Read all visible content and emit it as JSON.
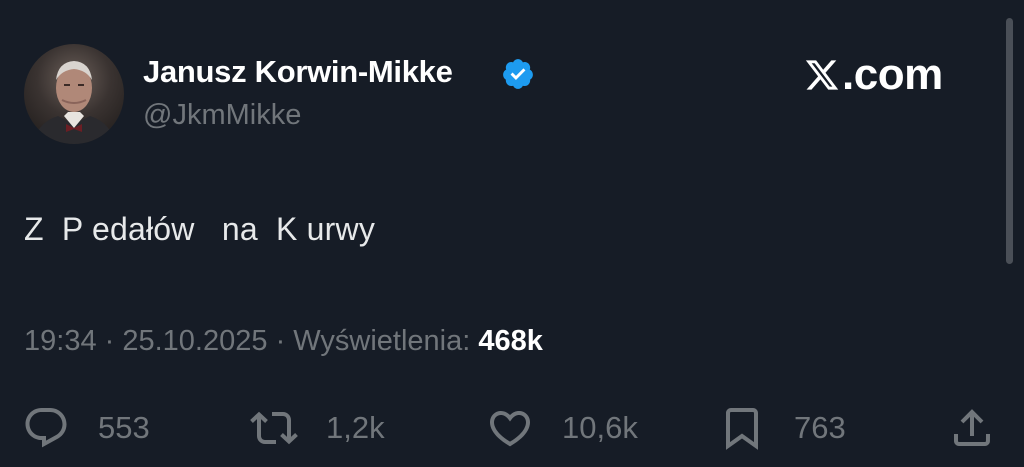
{
  "author": {
    "display_name": "Janusz Korwin-Mikke",
    "handle": "@JkmMikke",
    "verified": true,
    "verified_color": "#1d9bf0"
  },
  "brand": {
    "text": ".com",
    "icon": "x-logo-icon"
  },
  "tweet": {
    "text": "Z  P edałów   na  K urwy"
  },
  "meta": {
    "time": "19:34",
    "separator1": " · ",
    "date": "25.10.2025",
    "separator2": " · ",
    "views_label": "Wyświetlenia: ",
    "views_count": "468k"
  },
  "actions": {
    "reply": {
      "icon": "reply-icon",
      "count": "553"
    },
    "retweet": {
      "icon": "retweet-icon",
      "count": "1,2k"
    },
    "like": {
      "icon": "heart-icon",
      "count": "10,6k"
    },
    "bookmark": {
      "icon": "bookmark-icon",
      "count": "763"
    },
    "share": {
      "icon": "share-icon"
    }
  },
  "colors": {
    "background": "#161c26",
    "text": "#e7e9ea",
    "muted": "#71767b",
    "accent": "#1d9bf0"
  }
}
